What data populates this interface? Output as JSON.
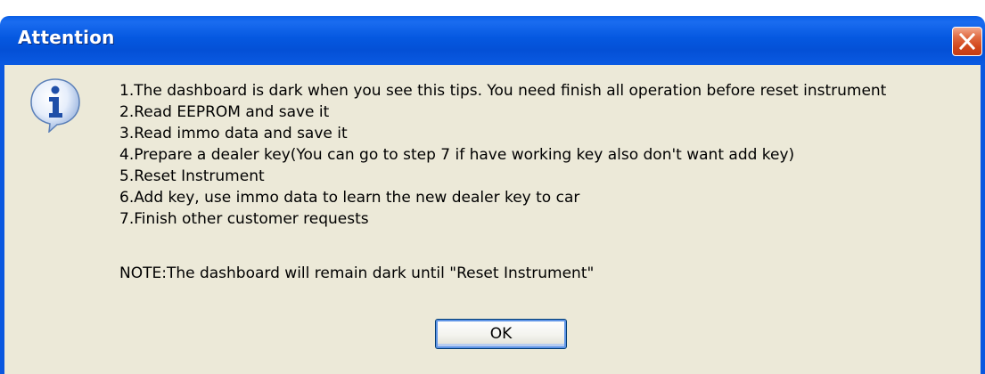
{
  "window": {
    "title": "Attention",
    "close_icon": "close-icon"
  },
  "dialog": {
    "icon": "info-icon",
    "messages": [
      "1.The dashboard is dark when you see this tips. You need finish all operation before reset instrument",
      "2.Read EEPROM and save it",
      "3.Read immo data and save it",
      "4.Prepare a dealer key(You can go to step 7 if have working key also don't want add key)",
      "5.Reset Instrument",
      "6.Add key, use immo data to learn the new dealer key to car",
      "7.Finish other customer requests"
    ],
    "note": "NOTE:The dashboard will remain dark until \"Reset Instrument\"",
    "ok_label": "OK"
  },
  "colors": {
    "titlebar": "#0558e0",
    "body": "#ece9d8",
    "close_button": "#d2481c"
  }
}
